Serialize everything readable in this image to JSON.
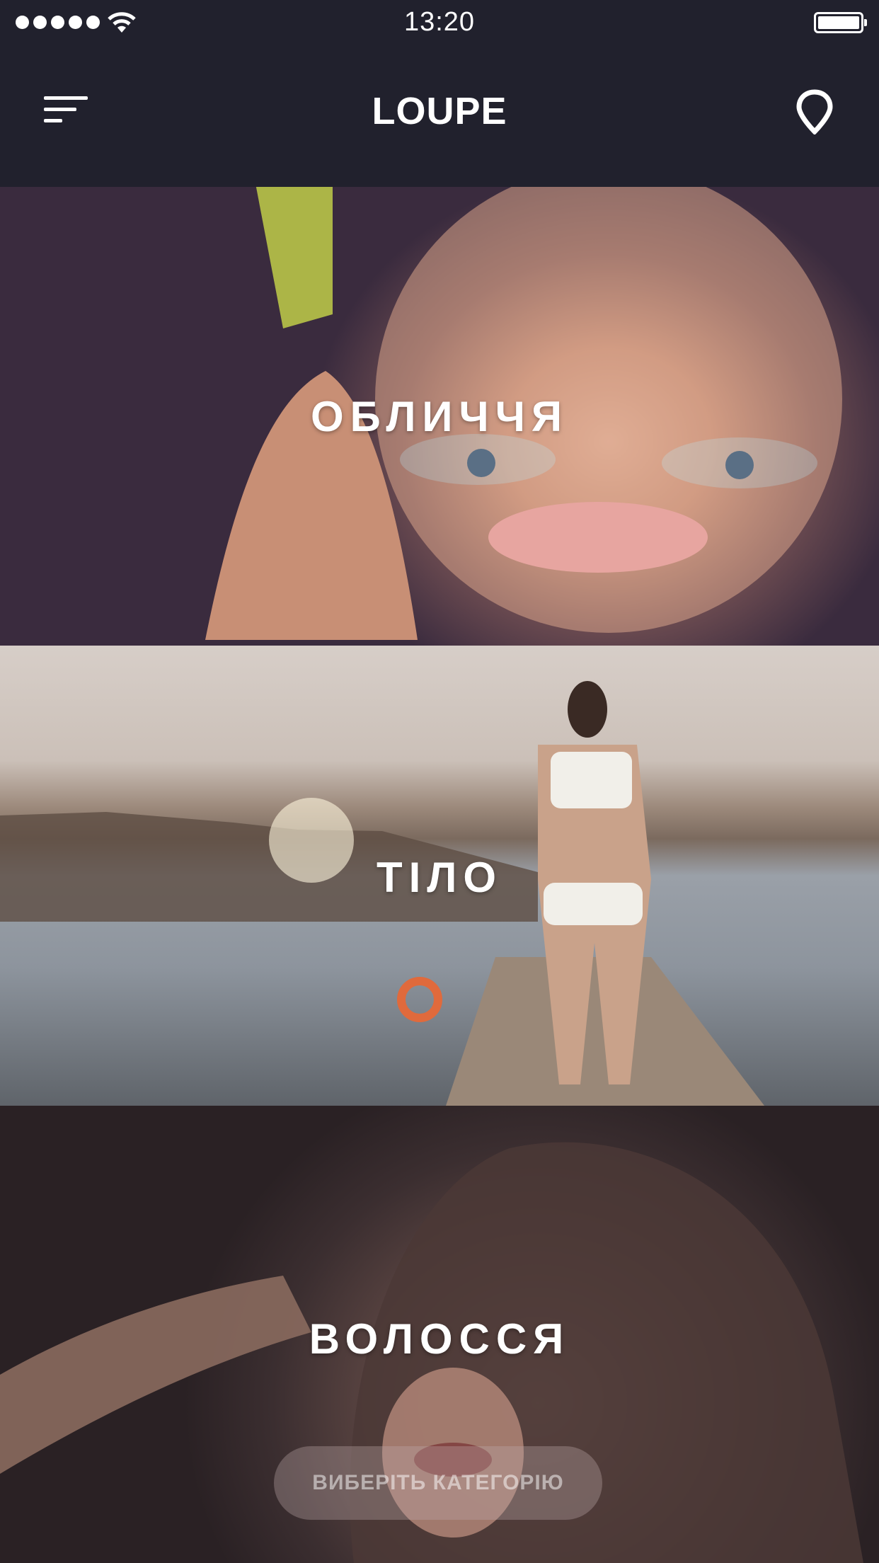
{
  "status_bar": {
    "time": "13:20"
  },
  "nav": {
    "title": "LOUPE",
    "menu_icon": "menu-icon",
    "location_icon": "location-pin-icon"
  },
  "categories": [
    {
      "label": "ОБЛИЧЧЯ"
    },
    {
      "label": "ТІЛО"
    },
    {
      "label": "ВОЛОССЯ"
    }
  ],
  "footer": {
    "select_label": "ВИБЕРІТЬ КАТЕГОРІЮ"
  },
  "colors": {
    "nav_background": "#21212d",
    "text": "#ffffff"
  }
}
